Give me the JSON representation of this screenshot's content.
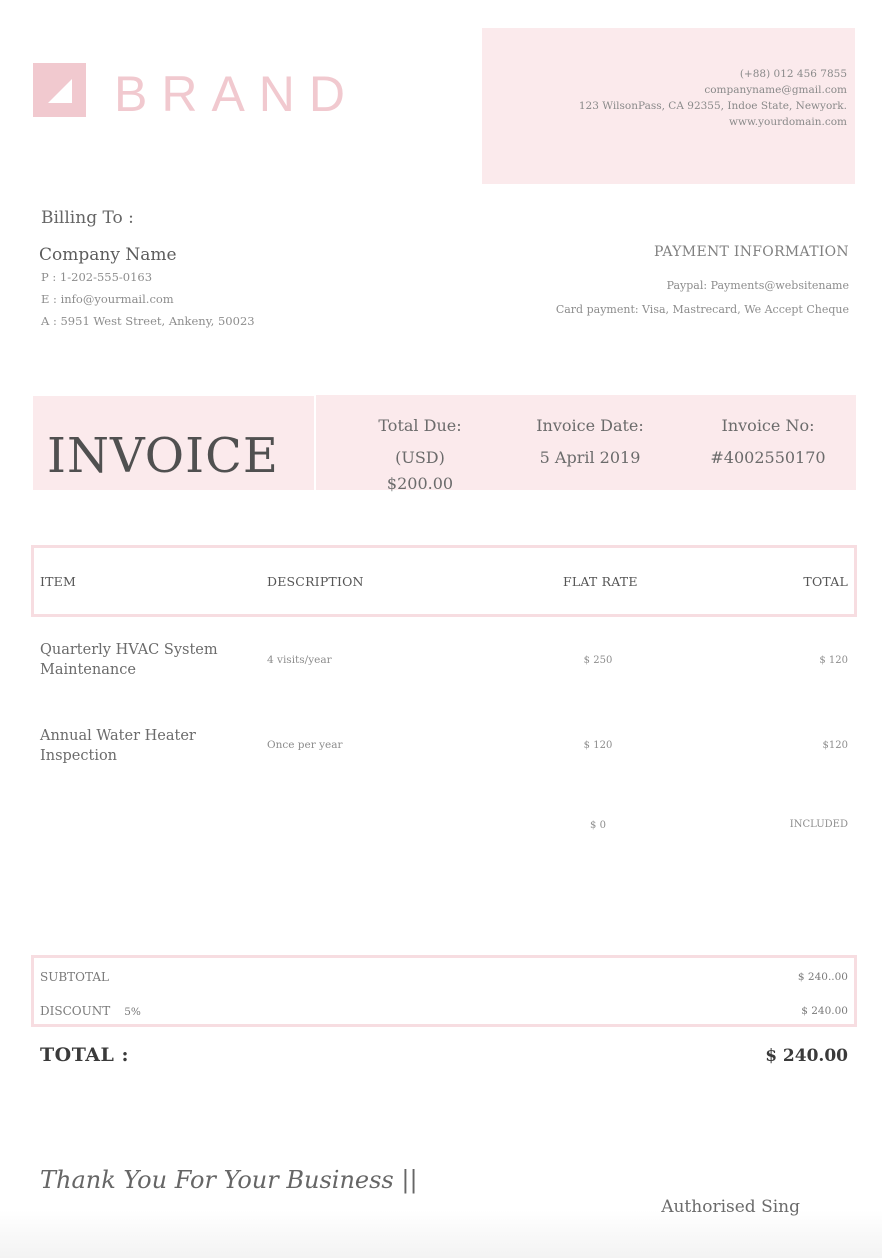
{
  "brand": {
    "logo_text": "BRAND",
    "accent_color": "#f1c9cf",
    "panel_color": "#fbeaec"
  },
  "contact": {
    "lines": [
      "(+88) 012 456 7855",
      "companyname@gmail.com",
      "123 WilsonPass, CA 92355, Indoe State, Newyork.",
      "www.yourdomain.com"
    ]
  },
  "billing": {
    "title": "Billing To :",
    "company": "Company Name",
    "phone": "P : 1-202-555-0163",
    "email": "E : info@yourmail.com",
    "address": "A : 5951 West Street, Ankeny, 50023"
  },
  "payment": {
    "title": "PAYMENT INFORMATION",
    "paypal": "Paypal: Payments@websitename",
    "card": "Card payment: Visa, Mastrecard, We Accept Cheque"
  },
  "invoice": {
    "title": "INVOICE",
    "total_due_label": "Total Due:",
    "total_due_value": "(USD) $200.00",
    "date_label": "Invoice Date:",
    "date_value": "5 April 2019",
    "number_label": "Invoice No:",
    "number_value": "#4002550170"
  },
  "table": {
    "headers": {
      "item": "ITEM",
      "description": "DESCRIPTION",
      "rate": "FLAT RATE",
      "total": "TOTAL"
    },
    "rows": [
      {
        "item_line1": "Quarterly HVAC System",
        "item_line2": "Maintenance",
        "description": "4 visits/year",
        "rate": "$ 250",
        "total": "$ 120"
      },
      {
        "item_line1": "Annual Water Heater",
        "item_line2": "Inspection",
        "description": "Once per year",
        "rate": "$ 120",
        "total": "$120"
      },
      {
        "item_line1": "",
        "item_line2": "",
        "description": "",
        "rate": "$ 0",
        "total": "INCLUDED"
      }
    ]
  },
  "summary": {
    "subtotal_label": "SUBTOTAL",
    "subtotal_value": "$ 240..00",
    "discount_label": "DISCOUNT",
    "discount_rate": "5%",
    "discount_value": "$ 240.00",
    "total_label": "TOTAL :",
    "total_value": "$ 240.00"
  },
  "footer": {
    "thanks": "Thank You For Your Business ||",
    "signature": "Authorised Sing"
  }
}
